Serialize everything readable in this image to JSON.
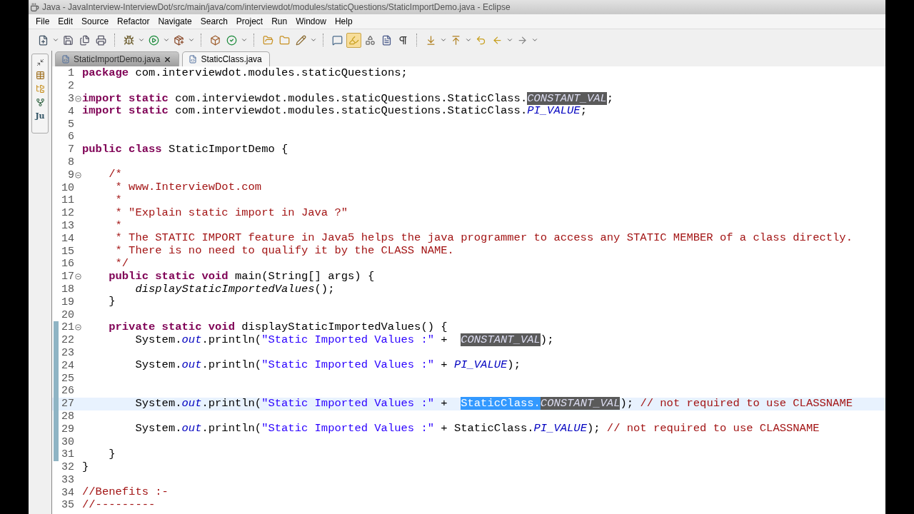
{
  "window": {
    "title": "Java - JavaInterview-InterviewDot/src/main/java/com/interviewdot/modules/staticQuestions/StaticImportDemo.java - Eclipse"
  },
  "menu": [
    "File",
    "Edit",
    "Source",
    "Refactor",
    "Navigate",
    "Search",
    "Project",
    "Run",
    "Window",
    "Help"
  ],
  "toolbar": [
    {
      "kind": "button",
      "dropdown": true,
      "pressed": false
    },
    {
      "kind": "button",
      "dropdown": false,
      "pressed": false
    },
    {
      "kind": "button",
      "dropdown": false,
      "pressed": false
    },
    {
      "kind": "button",
      "dropdown": false,
      "pressed": false
    },
    {
      "kind": "separator"
    },
    {
      "kind": "button",
      "dropdown": true,
      "pressed": false
    },
    {
      "kind": "button",
      "dropdown": true,
      "pressed": false
    },
    {
      "kind": "button",
      "dropdown": true,
      "pressed": false
    },
    {
      "kind": "separator"
    },
    {
      "kind": "button",
      "dropdown": false,
      "pressed": false
    },
    {
      "kind": "button",
      "dropdown": true,
      "pressed": false
    },
    {
      "kind": "separator"
    },
    {
      "kind": "button",
      "dropdown": false,
      "pressed": false
    },
    {
      "kind": "button",
      "dropdown": false,
      "pressed": false
    },
    {
      "kind": "button",
      "dropdown": true,
      "pressed": false
    },
    {
      "kind": "separator"
    },
    {
      "kind": "button",
      "dropdown": false,
      "pressed": false
    },
    {
      "kind": "button",
      "dropdown": false,
      "pressed": true
    },
    {
      "kind": "button",
      "dropdown": false,
      "pressed": false
    },
    {
      "kind": "button",
      "dropdown": false,
      "pressed": false
    },
    {
      "kind": "button",
      "dropdown": false,
      "pressed": false
    },
    {
      "kind": "separator"
    },
    {
      "kind": "button",
      "dropdown": true,
      "pressed": false
    },
    {
      "kind": "button",
      "dropdown": true,
      "pressed": false
    },
    {
      "kind": "button",
      "dropdown": false,
      "pressed": false
    },
    {
      "kind": "button",
      "dropdown": true,
      "pressed": false
    },
    {
      "kind": "button",
      "dropdown": true,
      "pressed": false
    }
  ],
  "side_stack": {
    "junit_label": "Ju"
  },
  "tabs": [
    {
      "label": "StaticImportDemo.java",
      "selected": true,
      "closable": true
    },
    {
      "label": "StaticClass.java",
      "selected": false,
      "closable": false
    }
  ],
  "editor": {
    "lines": [
      {
        "number": "1",
        "fold": false,
        "range": false,
        "current": false,
        "tokens": [
          {
            "kind": "keyword",
            "text": "package"
          },
          {
            "kind": "plain",
            "text": " com.interviewdot.modules.staticQuestions;"
          }
        ]
      },
      {
        "number": "2",
        "fold": false,
        "range": false,
        "current": false
      },
      {
        "number": "3",
        "fold": true,
        "range": false,
        "current": false,
        "tokens": [
          {
            "kind": "keyword",
            "text": "import static"
          },
          {
            "kind": "plain",
            "text": " com.interviewdot.modules.staticQuestions.StaticClass."
          },
          {
            "kind": "occurrence",
            "text": "CONSTANT_VAL"
          },
          {
            "kind": "plain",
            "text": ";"
          }
        ]
      },
      {
        "number": "4",
        "fold": false,
        "range": false,
        "current": false,
        "tokens": [
          {
            "kind": "keyword",
            "text": "import static"
          },
          {
            "kind": "plain",
            "text": " com.interviewdot.modules.staticQuestions.StaticClass."
          },
          {
            "kind": "field",
            "text": "PI_VALUE"
          },
          {
            "kind": "plain",
            "text": ";"
          }
        ]
      },
      {
        "number": "5",
        "fold": false,
        "range": false,
        "current": false
      },
      {
        "number": "6",
        "fold": false,
        "range": false,
        "current": false
      },
      {
        "number": "7",
        "fold": false,
        "range": false,
        "current": false,
        "tokens": [
          {
            "kind": "keyword",
            "text": "public class"
          },
          {
            "kind": "plain",
            "text": " StaticImportDemo {"
          }
        ]
      },
      {
        "number": "8",
        "fold": false,
        "range": false,
        "current": false
      },
      {
        "number": "9",
        "fold": true,
        "range": false,
        "current": false,
        "tokens": [
          {
            "kind": "comment",
            "text": "    /*"
          }
        ]
      },
      {
        "number": "10",
        "fold": false,
        "range": false,
        "current": false,
        "tokens": [
          {
            "kind": "comment",
            "text": "     * www.InterviewDot.com"
          }
        ]
      },
      {
        "number": "11",
        "fold": false,
        "range": false,
        "current": false,
        "tokens": [
          {
            "kind": "comment",
            "text": "     *"
          }
        ]
      },
      {
        "number": "12",
        "fold": false,
        "range": false,
        "current": false,
        "tokens": [
          {
            "kind": "comment",
            "text": "     * \"Explain static import in Java ?\""
          }
        ]
      },
      {
        "number": "13",
        "fold": false,
        "range": false,
        "current": false,
        "tokens": [
          {
            "kind": "comment",
            "text": "     *"
          }
        ]
      },
      {
        "number": "14",
        "fold": false,
        "range": false,
        "current": false,
        "tokens": [
          {
            "kind": "comment",
            "text": "     * The STATIC IMPORT feature in Java5 helps the java programmer to access any STATIC MEMBER of a class directly."
          }
        ]
      },
      {
        "number": "15",
        "fold": false,
        "range": false,
        "current": false,
        "tokens": [
          {
            "kind": "comment",
            "text": "     * There is no need to qualify it by the CLASS NAME."
          }
        ]
      },
      {
        "number": "16",
        "fold": false,
        "range": false,
        "current": false,
        "tokens": [
          {
            "kind": "comment",
            "text": "     */"
          }
        ]
      },
      {
        "number": "17",
        "fold": true,
        "range": false,
        "current": false,
        "tokens": [
          {
            "kind": "keyword",
            "text": "    public static void"
          },
          {
            "kind": "plain",
            "text": " main(String[] args) {"
          }
        ]
      },
      {
        "number": "18",
        "fold": false,
        "range": false,
        "current": false,
        "tokens": [
          {
            "kind": "static_call",
            "text": "        displayStaticImportedValues"
          },
          {
            "kind": "plain",
            "text": "();"
          }
        ]
      },
      {
        "number": "19",
        "fold": false,
        "range": false,
        "current": false,
        "tokens": [
          {
            "kind": "plain",
            "text": "    }"
          }
        ]
      },
      {
        "number": "20",
        "fold": false,
        "range": false,
        "current": false
      },
      {
        "number": "21",
        "fold": true,
        "range": true,
        "current": false,
        "tokens": [
          {
            "kind": "keyword",
            "text": "    private static void"
          },
          {
            "kind": "plain",
            "text": " displayStaticImportedValues() {"
          }
        ]
      },
      {
        "number": "22",
        "fold": false,
        "range": true,
        "current": false,
        "tokens": [
          {
            "kind": "plain",
            "text": "        System."
          },
          {
            "kind": "field",
            "text": "out"
          },
          {
            "kind": "plain",
            "text": ".println("
          },
          {
            "kind": "string",
            "text": "\"Static Imported Values :\""
          },
          {
            "kind": "plain",
            "text": " +  "
          },
          {
            "kind": "occurrence",
            "text": "CONSTANT_VAL"
          },
          {
            "kind": "plain",
            "text": ");"
          }
        ]
      },
      {
        "number": "23",
        "fold": false,
        "range": true,
        "current": false
      },
      {
        "number": "24",
        "fold": false,
        "range": true,
        "current": false,
        "tokens": [
          {
            "kind": "plain",
            "text": "        System."
          },
          {
            "kind": "field",
            "text": "out"
          },
          {
            "kind": "plain",
            "text": ".println("
          },
          {
            "kind": "string",
            "text": "\"Static Imported Values :\""
          },
          {
            "kind": "plain",
            "text": " + "
          },
          {
            "kind": "field",
            "text": "PI_VALUE"
          },
          {
            "kind": "plain",
            "text": ");"
          }
        ]
      },
      {
        "number": "25",
        "fold": false,
        "range": true,
        "current": false
      },
      {
        "number": "26",
        "fold": false,
        "range": true,
        "current": false
      },
      {
        "number": "27",
        "fold": false,
        "range": true,
        "current": true,
        "tokens": [
          {
            "kind": "plain",
            "text": "        System."
          },
          {
            "kind": "field",
            "text": "out"
          },
          {
            "kind": "plain",
            "text": ".println("
          },
          {
            "kind": "string",
            "text": "\"Static Imported Values :\""
          },
          {
            "kind": "plain",
            "text": " +  "
          },
          {
            "kind": "selection",
            "text": "StaticClass."
          },
          {
            "kind": "occurrence",
            "text": "CONSTANT_VAL"
          },
          {
            "kind": "plain",
            "text": ");"
          },
          {
            "kind": "comment",
            "text": " // not required to use CLASSNAME"
          }
        ]
      },
      {
        "number": "28",
        "fold": false,
        "range": true,
        "current": false
      },
      {
        "number": "29",
        "fold": false,
        "range": true,
        "current": false,
        "tokens": [
          {
            "kind": "plain",
            "text": "        System."
          },
          {
            "kind": "field",
            "text": "out"
          },
          {
            "kind": "plain",
            "text": ".println("
          },
          {
            "kind": "string",
            "text": "\"Static Imported Values :\""
          },
          {
            "kind": "plain",
            "text": " + StaticClass."
          },
          {
            "kind": "field",
            "text": "PI_VALUE"
          },
          {
            "kind": "plain",
            "text": ");"
          },
          {
            "kind": "comment",
            "text": " // not required to use CLASSNAME"
          }
        ]
      },
      {
        "number": "30",
        "fold": false,
        "range": true,
        "current": false
      },
      {
        "number": "31",
        "fold": false,
        "range": true,
        "current": false,
        "tokens": [
          {
            "kind": "plain",
            "text": "    }"
          }
        ]
      },
      {
        "number": "32",
        "fold": false,
        "range": false,
        "current": false,
        "tokens": [
          {
            "kind": "plain",
            "text": "}"
          }
        ]
      },
      {
        "number": "33",
        "fold": false,
        "range": false,
        "current": false
      },
      {
        "number": "34",
        "fold": false,
        "range": false,
        "current": false,
        "tokens": [
          {
            "kind": "comment",
            "text": "//Benefits :-"
          }
        ]
      },
      {
        "number": "35",
        "fold": false,
        "range": false,
        "current": false,
        "tokens": [
          {
            "kind": "comment",
            "text": "//---------"
          }
        ]
      }
    ]
  }
}
